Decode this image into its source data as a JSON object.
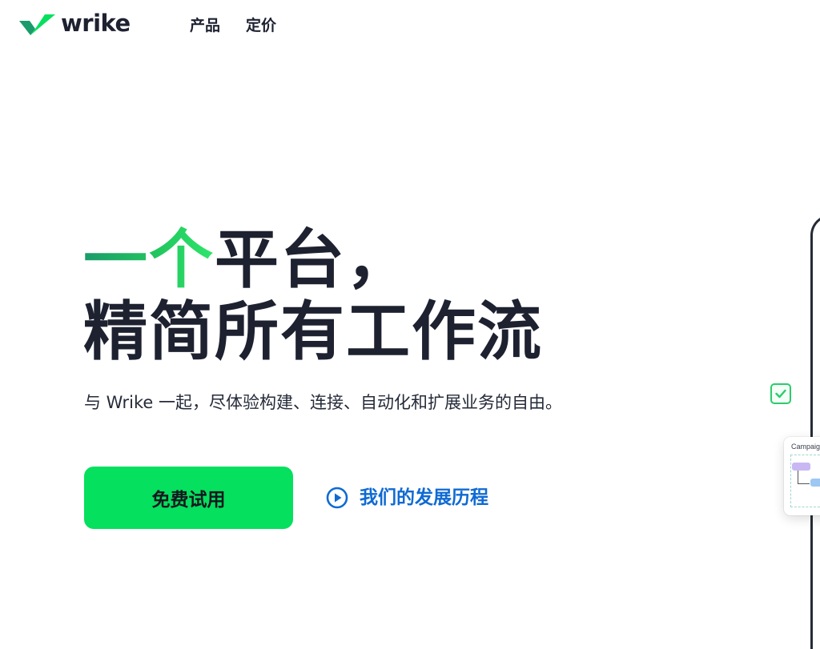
{
  "header": {
    "logo_text": "wrike",
    "nav": [
      {
        "label": "产品"
      },
      {
        "label": "定价"
      }
    ]
  },
  "hero": {
    "headline_accent": "一个",
    "headline_line1_rest": "平台，",
    "headline_line2": "精简所有工作流",
    "subtitle": "与 Wrike 一起，尽体验构建、连接、自动化和扩展业务的自由。",
    "cta_primary": "免费试用",
    "cta_secondary": "我们的发展历程"
  },
  "mockup": {
    "campaign_label": "Campaig"
  },
  "colors": {
    "brand_green": "#05e05e",
    "link_blue": "#0f6ad3",
    "text_dark": "#1d2130"
  },
  "icons": [
    "wrike-logo-icon",
    "play-circle-icon",
    "check-icon"
  ]
}
